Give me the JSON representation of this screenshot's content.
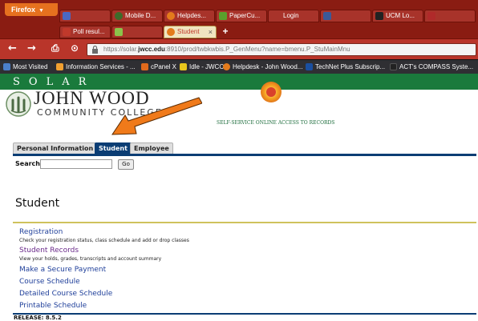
{
  "browser": {
    "app_button": "Firefox",
    "tabs_row1": [
      {
        "label": "",
        "icon_color": "#4a68c4"
      },
      {
        "label": "Mobile D...",
        "icon_color": "#3d6b2a"
      },
      {
        "label": "Helpdes...",
        "icon_color": "#e37b1c"
      },
      {
        "label": "PaperCu...",
        "icon_color": "#5aa02c"
      },
      {
        "label": "Login",
        "icon_color": ""
      },
      {
        "label": "",
        "icon_color": "#3b5998"
      },
      {
        "label": "UCM Lo...",
        "icon_color": "#222222"
      },
      {
        "label": "",
        "icon_color": "#b02a2a"
      }
    ],
    "tabs_row2": [
      {
        "label": "Poll resul...",
        "icon_color": "#c0392b"
      },
      {
        "label": "",
        "icon_color": "#8bc34a"
      },
      {
        "label": "Student",
        "icon_color": "#e37b1c",
        "active": true
      }
    ],
    "close_tab": "×",
    "new_tab": "+",
    "nav": {
      "back": "←",
      "forward": "→",
      "print": "⎙",
      "home": "⊙"
    },
    "url": {
      "prefix": "https://solar.",
      "domain": "jwcc.edu",
      "rest": ":8910/prod/twbkwbis.P_GenMenu?name=bmenu.P_StuMainMnu"
    },
    "bookmarks": [
      {
        "label": "Most Visited",
        "icon_color": "#4a7fc8"
      },
      {
        "label": "Information Services - ...",
        "icon_color": "#f0a030"
      },
      {
        "label": "cPanel X",
        "icon_color": "#e06a1c"
      },
      {
        "label": "Idle - JWCC",
        "icon_color": "#e8c61c"
      },
      {
        "label": "Helpdesk - John Wood...",
        "icon_color": "#e37b1c"
      },
      {
        "label": "TechNet Plus Subscrip...",
        "icon_color": "#1a4fa0"
      },
      {
        "label": "ACT's COMPASS Syste...",
        "icon_color": "#222222"
      }
    ]
  },
  "header": {
    "solar": "SOLAR",
    "college_name": "JOHN WOOD",
    "college_sub": "COMMUNITY COLLEGE",
    "tagline": "SELF-SERVICE ONLINE ACCESS TO RECORDS"
  },
  "tabs": [
    {
      "label": "Personal Information"
    },
    {
      "label": "Student",
      "active": true
    },
    {
      "label": "Employee"
    }
  ],
  "search": {
    "label": "Search",
    "value": "",
    "button": "Go"
  },
  "page_title": "Student",
  "menu": [
    {
      "label": "Registration",
      "desc": "Check your registration status, class schedule and add or drop classes"
    },
    {
      "label": "Student Records",
      "desc": "View your holds, grades, transcripts and account summary",
      "visited": true
    },
    {
      "label": "Make a Secure Payment",
      "desc": ""
    },
    {
      "label": "Course Schedule",
      "desc": ""
    },
    {
      "label": "Detailed Course Schedule",
      "desc": ""
    },
    {
      "label": "Printable Schedule",
      "desc": ""
    }
  ],
  "release": "RELEASE: 8.5.2",
  "colors": {
    "accent_navy": "#0b3d74",
    "brand_green": "#1a7a3c",
    "arrow": "#f07a1a",
    "browser_red": "#b9352a"
  }
}
